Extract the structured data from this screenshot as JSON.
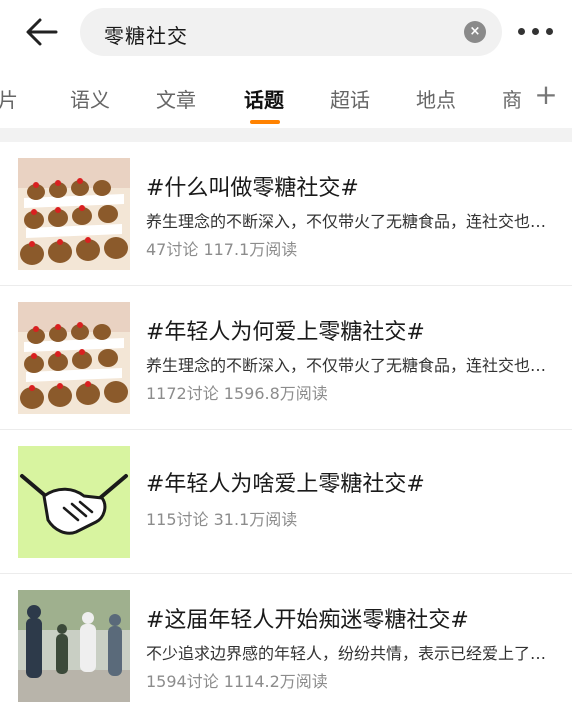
{
  "search": {
    "query": "零糖社交",
    "clear_label": "×"
  },
  "tabs": [
    {
      "label": "图片"
    },
    {
      "label": "语义"
    },
    {
      "label": "文章"
    },
    {
      "label": "话题",
      "active": true
    },
    {
      "label": "超话"
    },
    {
      "label": "地点"
    },
    {
      "label": "商"
    }
  ],
  "tab_add_label": "+",
  "accent_color": "#ff8200",
  "topics": [
    {
      "title": "#什么叫做零糖社交#",
      "desc": "养生理念的不断深入，不仅带火了无糖食品，连社交也开始讲究零糖了",
      "stats": "47讨论 117.1万阅读",
      "thumb": "capybara-plush-photo"
    },
    {
      "title": "#年轻人为何爱上零糖社交#",
      "desc": "养生理念的不断深入，不仅带火了无糖食品，连社交也开始讲究零糖了",
      "stats": "1172讨论 1596.8万阅读",
      "thumb": "capybara-plush-photo"
    },
    {
      "title": "#年轻人为啥爱上零糖社交#",
      "desc": "",
      "stats": "115讨论 31.1万阅读",
      "thumb": "handshake-illustration"
    },
    {
      "title": "#这届年轻人开始痴迷零糖社交#",
      "desc": "不少追求边界感的年轻人，纷纷共情，表示已经爱上了这种社交方式",
      "stats": "1594讨论 1114.2万阅读",
      "thumb": "people-outdoor-photo"
    }
  ]
}
